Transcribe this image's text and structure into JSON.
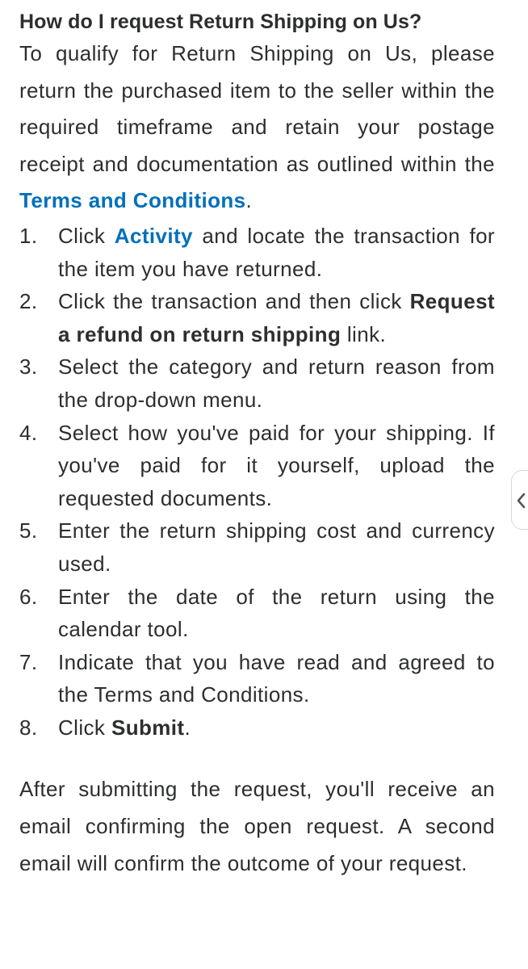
{
  "faq": {
    "title": "How do I request Return Shipping on Us?",
    "intro": {
      "before_link": "To qualify for Return Shipping on Us, please return the purchased item to the seller within the required timeframe and retain your postage receipt and documentation as outlined within the ",
      "link_text": "Terms and Conditions",
      "after_link": "."
    },
    "steps": [
      {
        "number": "1.",
        "before": "Click ",
        "link": "Activity",
        "after": " and locate the transaction for the item you have returned."
      },
      {
        "number": "2.",
        "before": "Click the transaction and then click ",
        "bold": "Request a refund on return shipping",
        "after": " link."
      },
      {
        "number": "3.",
        "text": "Select the category and return reason from the drop-down menu."
      },
      {
        "number": "4.",
        "text": "Select how you've paid for your shipping. If you've paid for it yourself, upload the requested documents."
      },
      {
        "number": "5.",
        "text": "Enter the return shipping cost and currency used."
      },
      {
        "number": "6.",
        "text": "Enter the date of the return using the calendar tool."
      },
      {
        "number": "7.",
        "text": "Indicate that you have read and agreed to the Terms and Conditions."
      },
      {
        "number": "8.",
        "before": "Click ",
        "bold": "Submit",
        "after": "."
      }
    ],
    "outro": "After submitting the request, you'll receive an email confirming the open request. A second email will confirm the outcome of your request."
  },
  "side_panel": {
    "icon": "chevron-left-icon"
  },
  "colors": {
    "text": "#2c2e2f",
    "link": "#0070ba",
    "background": "#ffffff"
  }
}
